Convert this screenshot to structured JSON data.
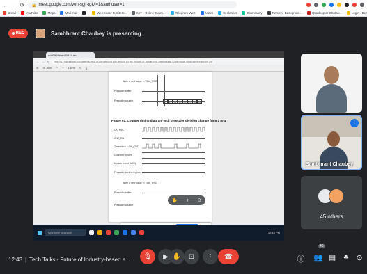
{
  "browser": {
    "url": "meet.google.com/veh-sgjr-tgk/l=1&authuser=1",
    "bookmarks": [
      {
        "label": "Gmail",
        "color": "#ea4335"
      },
      {
        "label": "YouTube",
        "color": "#ff0000"
      },
      {
        "label": "Maps",
        "color": "#34a853"
      },
      {
        "label": "Mail mail",
        "color": "#1a73e8"
      },
      {
        "label": "",
        "color": "#202124"
      },
      {
        "label": "WebCoder to SiteG...",
        "color": "#fbbc04"
      },
      {
        "label": "KIIT - Online Exam...",
        "color": "#5f6368"
      },
      {
        "label": "Telegram Web",
        "color": "#2aabee"
      },
      {
        "label": "Notes",
        "color": "#1a73e8"
      },
      {
        "label": "freelancer",
        "color": "#29b2fe"
      },
      {
        "label": "Grammarly",
        "color": "#15c39a"
      },
      {
        "label": "Remove Backgroun...",
        "color": "#3c4043"
      },
      {
        "label": "Quadcopter Obstac...",
        "color": "#c5221f"
      },
      {
        "label": "Login - BetterCreator",
        "color": "#fbbc04"
      }
    ]
  },
  "header": {
    "rec_label": "REC",
    "presenting_text": "Sambhrant Chaubey is presenting"
  },
  "presentation": {
    "tab_title": "en50919b-en50919-en...",
    "address": "file:///D:/Ideation/Documents/en50919/b-en50919b-en50919-en-en50919-advanced-armbased-32bit-mcus-stmicroelectronics.pdf",
    "page_info": "of 1694",
    "zoom": "150%",
    "doc_texts": {
      "caption": "Figure 61. Counter timing diagram with prescaler division change from 1 to 4",
      "ck_psc": "CK_PSC",
      "cnt_en": "CNT_EN",
      "timer_clock": "Timerclock = CK_CNT",
      "counter_register": "Counter register",
      "update_event": "Update event (UEV)",
      "prescaler_control": "Prescaler control register",
      "write_new_value": "Write a new value in TIMx_PSC",
      "prescaler_buffer": "Prescaler buffer",
      "prescaler_counter": "Prescaler counter",
      "cnt_values": [
        "F7",
        "F8",
        "F9",
        "FA",
        "FB",
        "FC",
        "00",
        "01"
      ]
    },
    "taskbar_search": "Type here to search",
    "taskbar_time": "12:43 PM",
    "share_banner_text": "meet.google.com is sharing your screen.",
    "stop_sharing": "Stop sharing",
    "hide": "Hide"
  },
  "participants": {
    "tile2_name": "Sambhrant Chaubey",
    "others_label": "45 others"
  },
  "bottom_bar": {
    "time": "12:43",
    "meeting_title": "Tech Talks - Future of Industry-based e...",
    "participant_count": "48"
  }
}
